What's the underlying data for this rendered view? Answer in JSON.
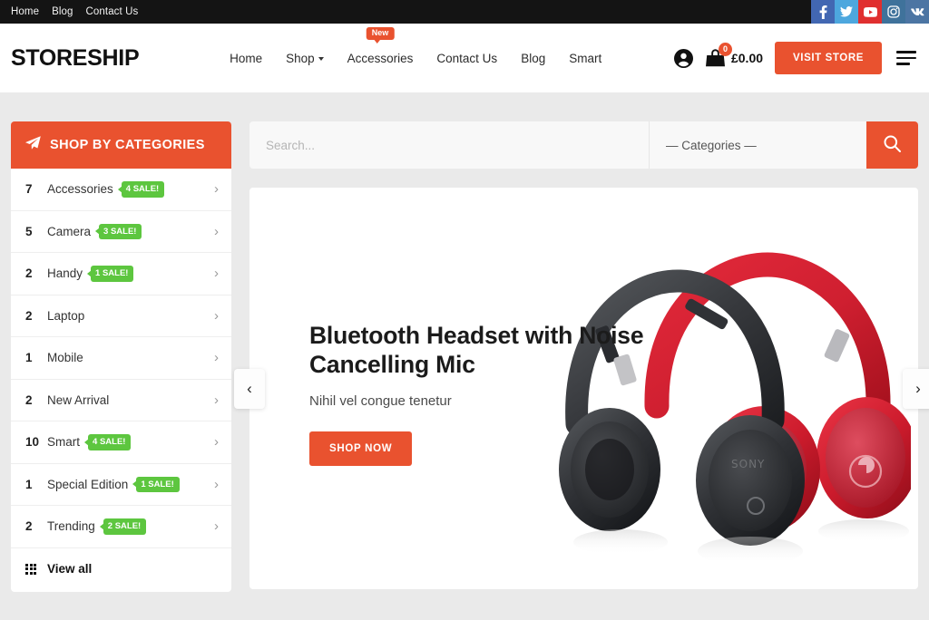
{
  "topbar": {
    "links": [
      {
        "label": "Home"
      },
      {
        "label": "Blog"
      },
      {
        "label": "Contact Us"
      }
    ],
    "socials": [
      {
        "name": "facebook-icon",
        "color": "#4267b2"
      },
      {
        "name": "twitter-icon",
        "color": "#4da7de"
      },
      {
        "name": "youtube-icon",
        "color": "#e02f2f"
      },
      {
        "name": "instagram-icon",
        "color": "#3f729b"
      },
      {
        "name": "vk-icon",
        "color": "#4c75a3"
      }
    ]
  },
  "header": {
    "logo": "STORESHIP",
    "nav": [
      {
        "label": "Home",
        "has_caret": false,
        "badge": null
      },
      {
        "label": "Shop",
        "has_caret": true,
        "badge": null
      },
      {
        "label": "Accessories",
        "has_caret": false,
        "badge": "New"
      },
      {
        "label": "Contact Us",
        "has_caret": false,
        "badge": null
      },
      {
        "label": "Blog",
        "has_caret": false,
        "badge": null
      },
      {
        "label": "Smart",
        "has_caret": false,
        "badge": null
      }
    ],
    "account_icon": "user-circle-icon",
    "cart": {
      "icon": "shopping-bag-icon",
      "count": "0",
      "total": "£0.00"
    },
    "visit_store_label": "VISIT STORE",
    "menu_icon": "hamburger-menu-icon"
  },
  "sidebar": {
    "title": "SHOP BY CATEGORIES",
    "title_icon": "paper-plane-icon",
    "categories": [
      {
        "count": "7",
        "name": "Accessories",
        "badge": "4 SALE!"
      },
      {
        "count": "5",
        "name": "Camera",
        "badge": "3 SALE!"
      },
      {
        "count": "2",
        "name": "Handy",
        "badge": "1 SALE!"
      },
      {
        "count": "2",
        "name": "Laptop",
        "badge": null
      },
      {
        "count": "1",
        "name": "Mobile",
        "badge": null
      },
      {
        "count": "2",
        "name": "New Arrival",
        "badge": null
      },
      {
        "count": "10",
        "name": "Smart",
        "badge": "4 SALE!"
      },
      {
        "count": "1",
        "name": "Special Edition",
        "badge": "1 SALE!"
      },
      {
        "count": "2",
        "name": "Trending",
        "badge": "2 SALE!"
      }
    ],
    "view_all": {
      "label": "View all",
      "icon": "grid-icon"
    }
  },
  "search": {
    "placeholder": "Search...",
    "value": "",
    "category_selected": "— Categories —",
    "button_icon": "search-icon"
  },
  "hero": {
    "title": "Bluetooth Headset with Noise Cancelling Mic",
    "subtitle": "Nihil vel congue tenetur",
    "cta_label": "SHOP NOW",
    "image_alt": "black-and-red-over-ear-headphones",
    "prev_icon": "chevron-left-icon",
    "next_icon": "chevron-right-icon"
  },
  "colors": {
    "accent": "#e9522f",
    "badge_green": "#5dc63f",
    "page_bg": "#eaeaea",
    "topbar_bg": "#141414"
  }
}
